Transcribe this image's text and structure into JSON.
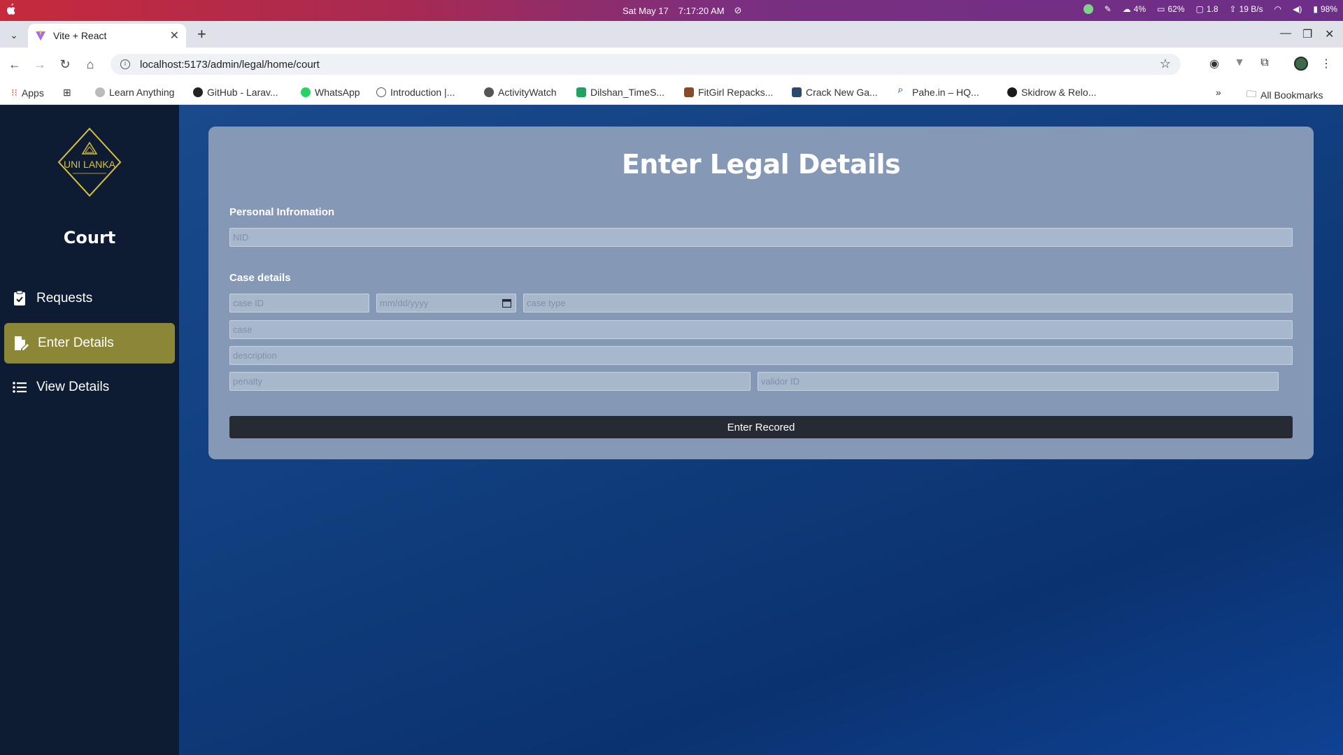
{
  "os_bar": {
    "date": "Sat May 17",
    "time": "7:17:20 AM",
    "tray": {
      "cpu": "4%",
      "battery_alt": "62%",
      "load": "1.8",
      "network": "19 B/s",
      "battery": "98%"
    }
  },
  "browser": {
    "tab_title": "Vite + React",
    "url": "localhost:5173/admin/legal/home/court",
    "bookmarks": [
      {
        "label": "Apps",
        "icon": "apps-grid-icon"
      },
      {
        "label": "Learn Anything",
        "icon": "bookmark-icon"
      },
      {
        "label": "GitHub - Larav...",
        "icon": "github-icon"
      },
      {
        "label": "WhatsApp",
        "icon": "whatsapp-icon"
      },
      {
        "label": "Introduction |...",
        "icon": "intro-icon"
      },
      {
        "label": "ActivityWatch",
        "icon": "activitywatch-icon"
      },
      {
        "label": "Dilshan_TimeS...",
        "icon": "sheets-icon"
      },
      {
        "label": "FitGirl Repacks...",
        "icon": "fitgirl-icon"
      },
      {
        "label": "Crack New Ga...",
        "icon": "crack-icon"
      },
      {
        "label": "Pahe.in – HQ...",
        "icon": "pahe-icon"
      },
      {
        "label": "Skidrow & Relo...",
        "icon": "skidrow-icon"
      }
    ],
    "all_bookmarks": "All Bookmarks"
  },
  "sidebar": {
    "logo_text": "UNI LANKA",
    "title": "Court",
    "items": [
      {
        "label": "Requests",
        "icon": "clipboard-check-icon"
      },
      {
        "label": "Enter Details",
        "icon": "file-edit-icon",
        "active": true
      },
      {
        "label": "View Details",
        "icon": "list-icon"
      }
    ]
  },
  "form": {
    "title": "Enter Legal Details",
    "personal_section": "Personal Infromation",
    "nid_placeholder": "NID",
    "case_section": "Case details",
    "case_id_placeholder": "case ID",
    "date_placeholder": "mm/dd/yyyy",
    "case_type_placeholder": "case type",
    "case_placeholder": "case",
    "description_placeholder": "description",
    "penalty_placeholder": "penalty",
    "validor_placeholder": "validor ID",
    "submit_label": "Enter Recored"
  },
  "colors": {
    "sidebar_bg": "#0d1b33",
    "active_item": "#8c8637",
    "card_bg": "#8599b6",
    "button_bg": "#252a33",
    "logo_gold": "#d8c23a"
  }
}
